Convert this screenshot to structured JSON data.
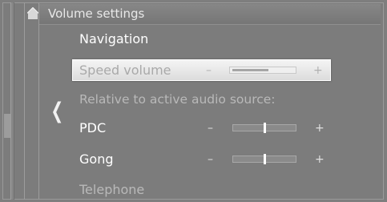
{
  "header": {
    "title": "Volume settings"
  },
  "icons": {
    "home": "home-icon",
    "back": "chevron-left-icon",
    "back_glyph": "❮"
  },
  "menu": {
    "navigation_label": "Navigation",
    "speed_volume": {
      "label": "Speed volume",
      "minus": "–",
      "plus": "+",
      "level": 0.55
    },
    "section_label": "Relative to active audio source:",
    "pdc": {
      "label": "PDC",
      "minus": "–",
      "plus": "+",
      "level": 0.5
    },
    "gong": {
      "label": "Gong",
      "minus": "–",
      "plus": "+",
      "level": 0.5
    },
    "telephone_label": "Telephone"
  },
  "colors": {
    "background": "#7e7e7e",
    "highlight": "#e8e8e8",
    "text": "#ffffff",
    "dim_text": "#b9b9b9"
  }
}
